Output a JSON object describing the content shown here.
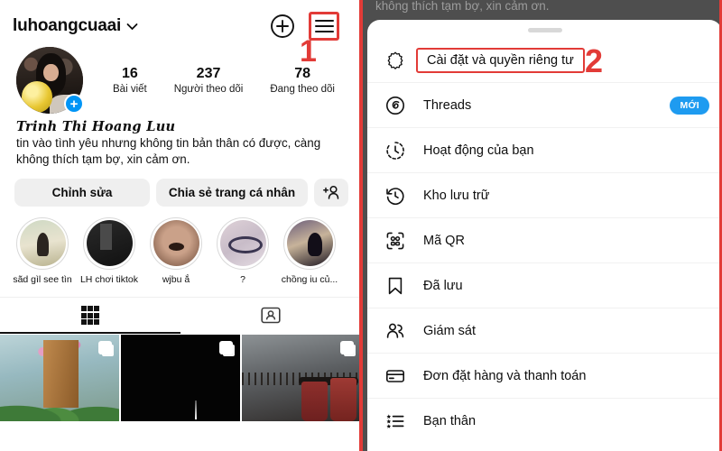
{
  "profile": {
    "username": "luhoangcuaai",
    "display_name": "Trinh Thi Hoang Luu",
    "bio": "tin vào tình yêu nhưng không tin bản thân có được, càng không thích tạm bợ, xin cảm ơn.",
    "stats": [
      {
        "value": "16",
        "label": "Bài viết"
      },
      {
        "value": "237",
        "label": "Người theo dõi"
      },
      {
        "value": "78",
        "label": "Đang theo dõi"
      }
    ],
    "actions": {
      "edit": "Chỉnh sửa",
      "share": "Chia sẻ trang cá nhân",
      "add_person_icon": "add-person-icon"
    },
    "highlights": [
      {
        "label": "sãd gìl see tìn"
      },
      {
        "label": "LH chơi tiktok"
      },
      {
        "label": "wjbu ắ"
      },
      {
        "label": "?"
      },
      {
        "label": "chồng iu củ..."
      }
    ],
    "tabs": [
      {
        "icon": "grid-icon",
        "active": true
      },
      {
        "icon": "tagged-person-icon",
        "active": false
      }
    ],
    "posts": [
      {
        "name": "post-floral-doorway",
        "carousel": true
      },
      {
        "name": "post-dark-night",
        "carousel": true
      },
      {
        "name": "post-cafe-coffee",
        "carousel": true
      }
    ],
    "header_icons": {
      "chevron": "chevron-down-icon",
      "add": "plus-square-icon",
      "menu": "hamburger-menu-icon"
    }
  },
  "menu": {
    "dim_background_text": "không thích tạm bợ, xin cảm ơn.",
    "items": [
      {
        "icon": "gear-icon",
        "label": "Cài đặt và quyền riêng tư",
        "highlighted": true,
        "badge": ""
      },
      {
        "icon": "threads-icon",
        "label": "Threads",
        "highlighted": false,
        "badge": "MỚI"
      },
      {
        "icon": "activity-icon",
        "label": "Hoạt động của bạn",
        "highlighted": false,
        "badge": ""
      },
      {
        "icon": "archive-icon",
        "label": "Kho lưu trữ",
        "highlighted": false,
        "badge": ""
      },
      {
        "icon": "qr-code-icon",
        "label": "Mã QR",
        "highlighted": false,
        "badge": ""
      },
      {
        "icon": "bookmark-icon",
        "label": "Đã lưu",
        "highlighted": false,
        "badge": ""
      },
      {
        "icon": "supervision-icon",
        "label": "Giám sát",
        "highlighted": false,
        "badge": ""
      },
      {
        "icon": "card-icon",
        "label": "Đơn đặt hàng và thanh toán",
        "highlighted": false,
        "badge": ""
      },
      {
        "icon": "star-list-icon",
        "label": "Bạn thân",
        "highlighted": false,
        "badge": ""
      }
    ]
  },
  "annotations": [
    {
      "text": "1"
    },
    {
      "text": "2"
    }
  ],
  "colors": {
    "annotation_red": "#e23b37",
    "badge_blue": "#1e9bf0",
    "button_gray": "#efefef",
    "text_dark": "#0d0d0d",
    "dim_overlay": "#4e4e4e"
  }
}
